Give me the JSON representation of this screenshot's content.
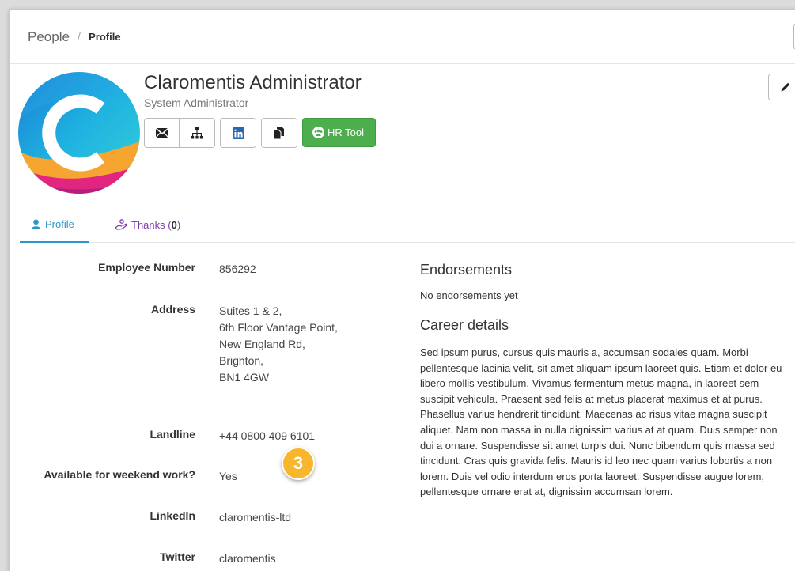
{
  "breadcrumb": {
    "root": "People",
    "separator": "/",
    "current": "Profile"
  },
  "person": {
    "name": "Claromentis Administrator",
    "role": "System Administrator"
  },
  "actions": {
    "icons": [
      "envelope-icon",
      "org-chart-icon",
      "linkedin-icon",
      "documents-icon"
    ],
    "hr_tool_label": "HR Tool",
    "hr_tool_color": "#4cae4c"
  },
  "tabs": {
    "profile_label": "Profile",
    "thanks_label": "Thanks (",
    "thanks_count": "0",
    "thanks_close": ")"
  },
  "details": {
    "employee_number_label": "Employee Number",
    "employee_number": "856292",
    "address_label": "Address",
    "address_lines": [
      "Suites 1 & 2,",
      "6th Floor Vantage Point,",
      "New England Rd,",
      "Brighton,",
      "BN1 4GW"
    ],
    "landline_label": "Landline",
    "landline": "+44 0800 409 6101",
    "weekend_label": "Available for weekend work?",
    "weekend": "Yes",
    "linkedin_label": "LinkedIn",
    "linkedin": "claromentis-ltd",
    "twitter_label": "Twitter",
    "twitter": "claromentis"
  },
  "step_badge": "3",
  "endorsements": {
    "title": "Endorsements",
    "empty": "No endorsements yet"
  },
  "career": {
    "title": "Career details",
    "text": "Sed ipsum purus, cursus quis mauris a, accumsan sodales quam. Morbi pellentesque lacinia velit, sit amet aliquam ipsum laoreet quis. Etiam et dolor eu libero mollis vestibulum. Vivamus fermentum metus magna, in laoreet sem suscipit vehicula. Praesent sed felis at metus placerat maximus et at purus. Phasellus varius hendrerit tincidunt. Maecenas ac risus vitae magna suscipit aliquet. Nam non massa in nulla dignissim varius at at quam. Duis semper non dui a ornare. Suspendisse sit amet turpis dui. Nunc bibendum quis massa sed tincidunt. Cras quis gravida felis. Mauris id leo nec quam varius lobortis a non lorem. Duis vel odio interdum eros porta laoreet. Suspendisse augue lorem, pellentesque ornare erat at, dignissim accumsan lorem."
  },
  "colors": {
    "accent_blue": "#2a97c9",
    "thanks_purple": "#7a3ea8",
    "badge_orange": "#f7b62c"
  }
}
